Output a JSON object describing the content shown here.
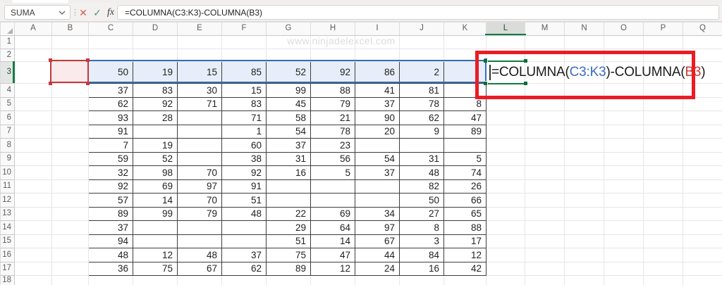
{
  "formula_bar": {
    "name_box": "SUMA",
    "formula": "=COLUMNA(C3:K3)-COLUMNA(B3)",
    "fx_label": "fx",
    "cancel_icon": "✕",
    "enter_icon": "✓",
    "dots_icon": "⋮"
  },
  "watermark": "www.ninjadelexcel.com",
  "sheet": {
    "columns": [
      "A",
      "B",
      "C",
      "D",
      "E",
      "F",
      "G",
      "H",
      "I",
      "J",
      "K",
      "L",
      "M",
      "N",
      "O",
      "P",
      "Q"
    ],
    "row_count": 18,
    "active_column": "L",
    "active_row": "3",
    "selection_range": "C3:K3",
    "reference_cell": "B3",
    "data_columns": [
      "C",
      "D",
      "E",
      "F",
      "G",
      "H",
      "I",
      "J",
      "K"
    ],
    "data_first_row": 3,
    "values": [
      [
        "50",
        "19",
        "15",
        "85",
        "52",
        "92",
        "86",
        "2",
        ""
      ],
      [
        "37",
        "83",
        "30",
        "15",
        "99",
        "88",
        "41",
        "81",
        ""
      ],
      [
        "62",
        "92",
        "71",
        "83",
        "45",
        "79",
        "37",
        "78",
        "8"
      ],
      [
        "93",
        "28",
        "",
        "71",
        "58",
        "21",
        "90",
        "62",
        "47"
      ],
      [
        "91",
        "",
        "",
        "1",
        "54",
        "78",
        "20",
        "9",
        "89"
      ],
      [
        "7",
        "19",
        "",
        "60",
        "37",
        "23",
        "",
        "",
        ""
      ],
      [
        "59",
        "52",
        "",
        "38",
        "31",
        "56",
        "54",
        "31",
        "5"
      ],
      [
        "32",
        "98",
        "70",
        "92",
        "16",
        "5",
        "37",
        "48",
        "74"
      ],
      [
        "92",
        "69",
        "97",
        "91",
        "",
        "",
        "",
        "82",
        "26"
      ],
      [
        "57",
        "14",
        "70",
        "51",
        "",
        "",
        "",
        "50",
        "66"
      ],
      [
        "89",
        "99",
        "79",
        "48",
        "22",
        "69",
        "34",
        "27",
        "65"
      ],
      [
        "37",
        "",
        "",
        "",
        "29",
        "64",
        "97",
        "8",
        "88"
      ],
      [
        "94",
        "",
        "",
        "",
        "51",
        "14",
        "67",
        "3",
        "17"
      ],
      [
        "48",
        "12",
        "48",
        "37",
        "75",
        "47",
        "44",
        "84",
        "12"
      ],
      [
        "36",
        "75",
        "67",
        "62",
        "89",
        "12",
        "24",
        "16",
        "42"
      ]
    ]
  },
  "cell_editor": {
    "segments": [
      {
        "text": "=COLUMNA(",
        "color": "black"
      },
      {
        "text": "C3:K3",
        "color": "blue"
      },
      {
        "text": ")-COLUMNA(",
        "color": "black"
      },
      {
        "text": "B3",
        "color": "red"
      },
      {
        "text": ")",
        "color": "black"
      }
    ]
  },
  "colors": {
    "accent_green": "#107C41",
    "selection_blue": "#2E6FBD",
    "reference_red": "#C5393C",
    "ref_text_blue": "#3B6CC4",
    "ref_text_red": "#C63D35",
    "annotation_red": "#EC1C24"
  }
}
